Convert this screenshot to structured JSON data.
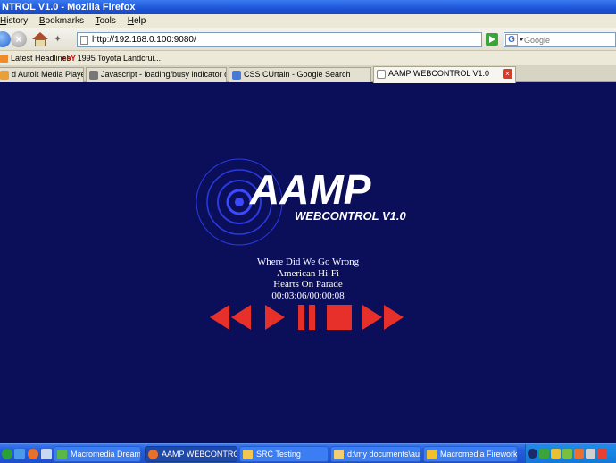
{
  "window": {
    "title": "NTROL V1.0 - Mozilla Firefox"
  },
  "menu": [
    {
      "key": "H",
      "rest": "istory"
    },
    {
      "key": "B",
      "rest": "ookmarks"
    },
    {
      "key": "T",
      "rest": "ools"
    },
    {
      "key": "H",
      "rest": "elp"
    }
  ],
  "nav": {
    "url": "http://192.168.0.100:9080/",
    "search_placeholder": "Google"
  },
  "bookmarks": [
    {
      "label": "Latest Headlines",
      "icon": "rss-icon"
    },
    {
      "label": "1995 Toyota Landcrui...",
      "icon": "ebay-icon",
      "icon_text": "ebY"
    }
  ],
  "tabs": [
    {
      "label": "d AutoIt Media Player -...",
      "icon_color": "#e8a03a",
      "active": false
    },
    {
      "label": "Javascript - loading/busy indicator or t...",
      "icon_color": "#777777",
      "active": false
    },
    {
      "label": "CSS CUrtain - Google Search",
      "icon_color": "#4a7ad8",
      "active": false
    },
    {
      "label": "AAMP WEBCONTROL V1.0",
      "icon_color": "#ffffff",
      "active": true
    }
  ],
  "player": {
    "logo_title": "AAMP",
    "logo_subtitle": "WEBCONTROL V1.0",
    "track_title": "Where Did We Go Wrong",
    "artist": "American Hi-Fi",
    "album": "Hearts On Parade",
    "time": "00:03:06/00:00:08",
    "accent_color": "#e8302a",
    "controls": [
      "rewind-icon",
      "play-icon",
      "pause-icon",
      "stop-icon",
      "fast-forward-icon"
    ]
  },
  "taskbar": {
    "tasks": [
      {
        "label": "Macromedia Dreamw...",
        "icon_color": "#5ab84a",
        "active": false
      },
      {
        "label": "AAMP WEBCONTROL...",
        "icon_color": "#e8702a",
        "active": true
      },
      {
        "label": "SRC Testing",
        "icon_color": "#f0c850",
        "active": false
      },
      {
        "label": "d:\\my documents\\aut...",
        "icon_color": "#f0d070",
        "active": false
      },
      {
        "label": "Macromedia Firework...",
        "icon_color": "#f0c030",
        "active": false
      }
    ]
  }
}
